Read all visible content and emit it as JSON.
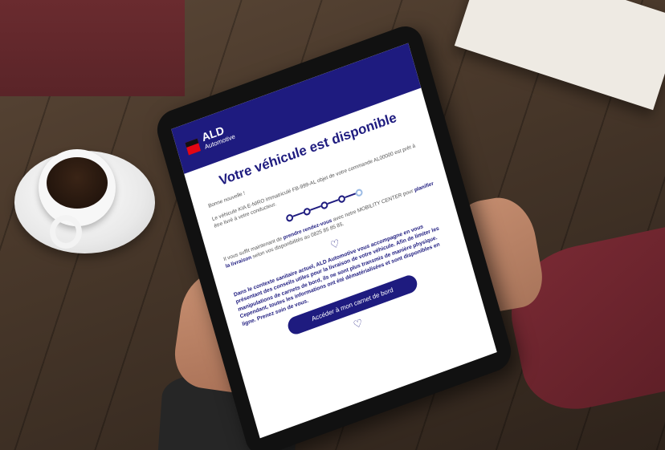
{
  "email": {
    "brand": "ALD",
    "brand_sub": "Automotive",
    "title": "Votre véhicule est disponible",
    "greeting": "Bonne nouvelle !",
    "intro": "Le véhicule KIA E-NIRO immatriculé FB-999-AL objet de votre commande AL00000 est prêt à être livré à votre conducteur.",
    "step_text_pre": "Il vous suffit maintenant de ",
    "step_text_b1": "prendre rendez-vous",
    "step_text_mid": " avec notre MOBILITY CENTER pour ",
    "step_text_b2": "planifier la livraison",
    "step_text_post": " selon vos disponibilités au 0825 85 85 85.",
    "notice": "Dans le contexte sanitaire actuel, ALD Automotive vous accompagne en vous présentant des conseils utiles pour la livraison de votre véhicule. Afin de limiter les manipulations de carnets de bord, ils ne sont plus transmis de manière physique. Cependant, toutes les informations ont été dématérialisées et sont disponibles en ligne. Prenez soin de vous.",
    "cta": "Accéder à mon carnet de bord",
    "progress_steps": 5,
    "progress_done": 4
  }
}
